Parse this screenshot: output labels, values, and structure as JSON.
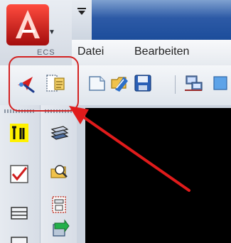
{
  "app": {
    "logo_label": "ECS",
    "menu": {
      "items": [
        {
          "label": "Datei"
        },
        {
          "label": "Bearbeiten"
        }
      ]
    }
  },
  "toolbar": {
    "buttons": [
      {
        "icon": "select-arrow-icon"
      },
      {
        "icon": "properties-icon"
      },
      {
        "icon": "new-document-icon"
      },
      {
        "icon": "open-folder-icon"
      },
      {
        "icon": "save-disk-icon"
      },
      {
        "icon": "network-computer-icon"
      }
    ]
  },
  "annotation": {
    "highlight_color": "#d32222",
    "arrow_color": "#e01b1b"
  },
  "colors": {
    "title_bar": "#1c4d9b",
    "drawing_background": "#000000"
  }
}
